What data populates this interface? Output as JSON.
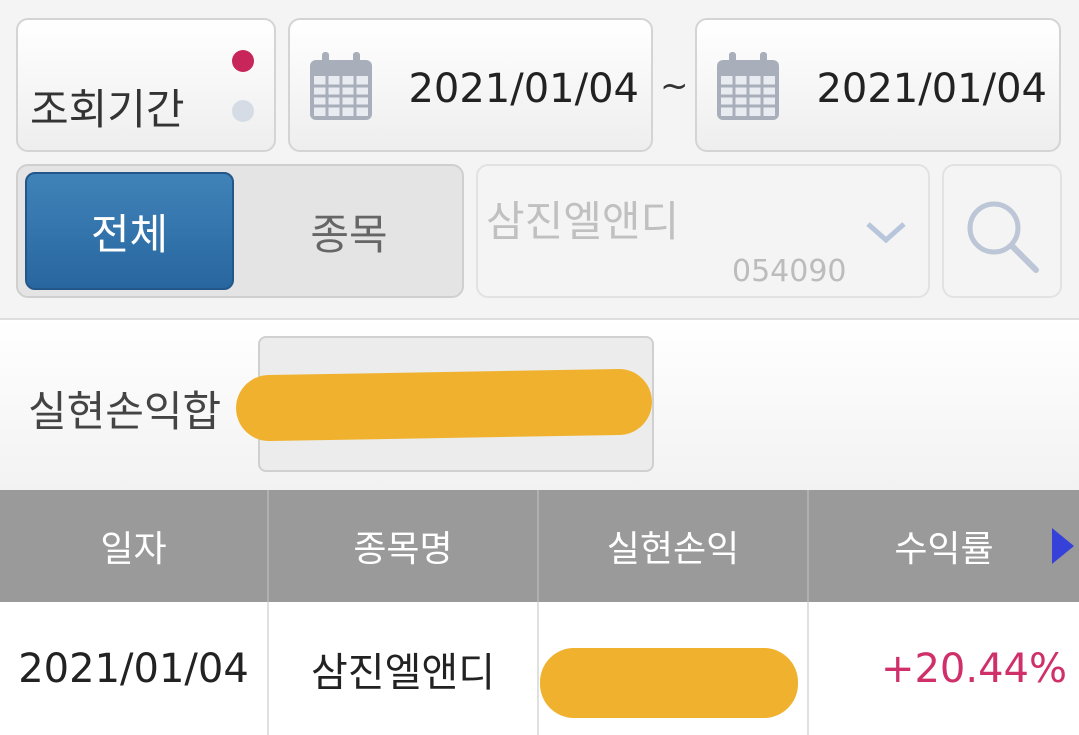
{
  "filter": {
    "period_label": "조회기간",
    "start_date": "2021/01/04",
    "separator": "~",
    "end_date": "2021/01/04",
    "segment_all": "전체",
    "segment_stock": "종목",
    "stock_name": "삼진엘앤디",
    "stock_code": "054090"
  },
  "summary": {
    "label": "실현손익합"
  },
  "table": {
    "headers": [
      "일자",
      "종목명",
      "실현손익",
      "수익률"
    ],
    "rows": [
      {
        "date": "2021/01/04",
        "name": "삼진엘앤디",
        "profit": "",
        "return": "+20.44%"
      }
    ]
  },
  "colors": {
    "accent": "#2c6ba3",
    "positive": "#d0306a",
    "redaction": "#f0b22e",
    "header_bg": "#9a9a9a"
  },
  "icons": [
    "calendar-icon",
    "chevron-down-icon",
    "search-icon",
    "play-right-icon"
  ]
}
